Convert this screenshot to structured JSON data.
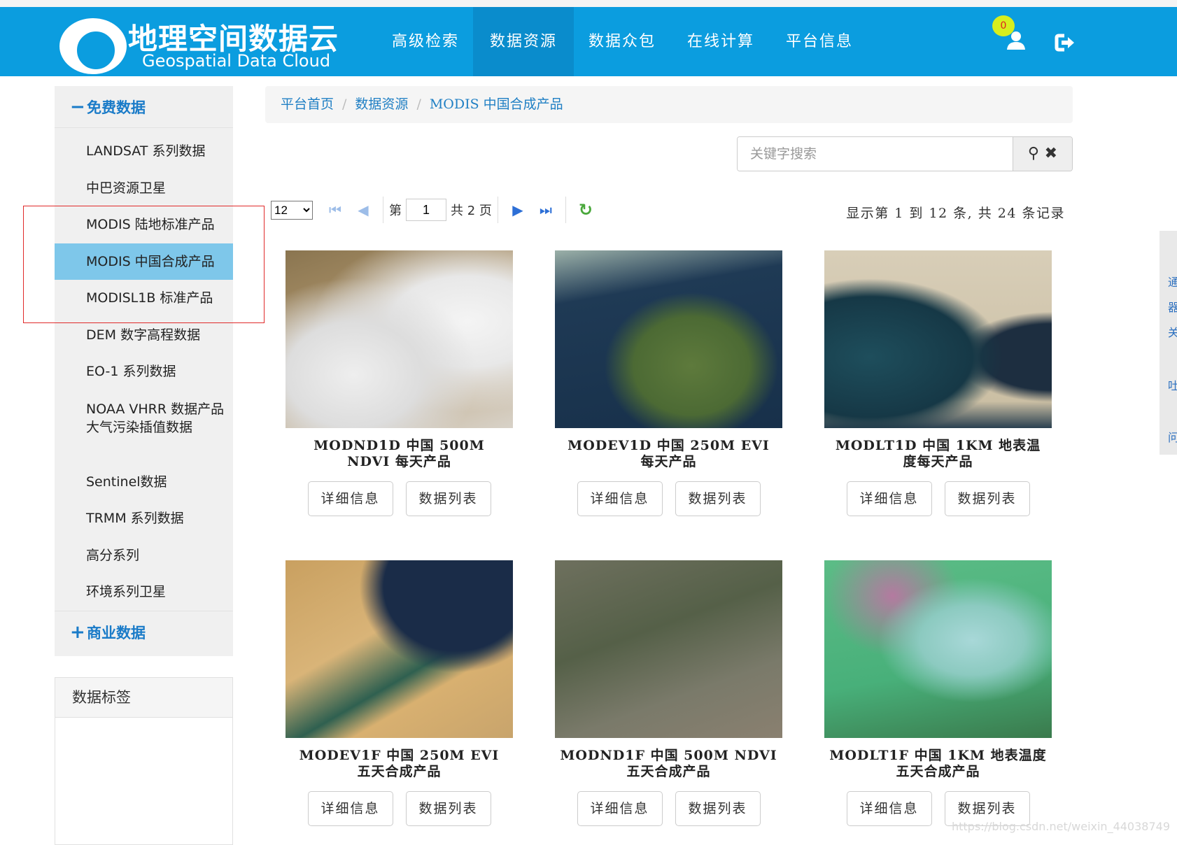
{
  "header": {
    "logo_cn": "地理空间数据云",
    "logo_en": "Geospatial Data Cloud",
    "nav": [
      "高级检索",
      "数据资源",
      "数据众包",
      "在线计算",
      "平台信息"
    ],
    "active_nav": 1,
    "badge": "0"
  },
  "sidebar": {
    "free_title": "免费数据",
    "free_sign": "−",
    "items": [
      "LANDSAT 系列数据",
      "中巴资源卫星",
      "MODIS 陆地标准产品",
      "MODIS 中国合成产品",
      "MODISL1B 标准产品",
      "DEM 数字高程数据",
      "EO-1 系列数据",
      "NOAA VHRR 数据产品",
      "大气污染插值数据",
      "Sentinel数据",
      "TRMM 系列数据",
      "高分系列",
      "环境系列卫星"
    ],
    "active_item": 3,
    "commercial_title": "商业数据",
    "commercial_sign": "+",
    "tags_title": "数据标签"
  },
  "breadcrumb": [
    "平台首页",
    "数据资源",
    "MODIS 中国合成产品"
  ],
  "search": {
    "placeholder": "关键字搜索",
    "value": ""
  },
  "pager": {
    "page_size": "12",
    "label_page": "第",
    "current": "1",
    "total_label": "共 2 页",
    "info": "显示第 1 到 12 条, 共 24 条记录"
  },
  "cards": [
    {
      "title": "MODND1D 中国 500M NDVI 每天产品",
      "detail": "详细信息",
      "list": "数据列表"
    },
    {
      "title": "MODEV1D 中国 250M EVI 每天产品",
      "detail": "详细信息",
      "list": "数据列表"
    },
    {
      "title": "MODLT1D 中国 1KM 地表温度每天产品",
      "detail": "详细信息",
      "list": "数据列表"
    },
    {
      "title": "MODEV1F 中国 250M EVI 五天合成产品",
      "detail": "详细信息",
      "list": "数据列表"
    },
    {
      "title": "MODND1F 中国 500M NDVI 五天合成产品",
      "detail": "详细信息",
      "list": "数据列表"
    },
    {
      "title": "MODLT1F 中国 1KM 地表温度五天合成产品",
      "detail": "详细信息",
      "list": "数据列表"
    }
  ],
  "float_panel": [
    "通",
    "器",
    "关",
    "吐",
    "问"
  ],
  "watermark": "https://blog.csdn.net/weixin_44038749"
}
